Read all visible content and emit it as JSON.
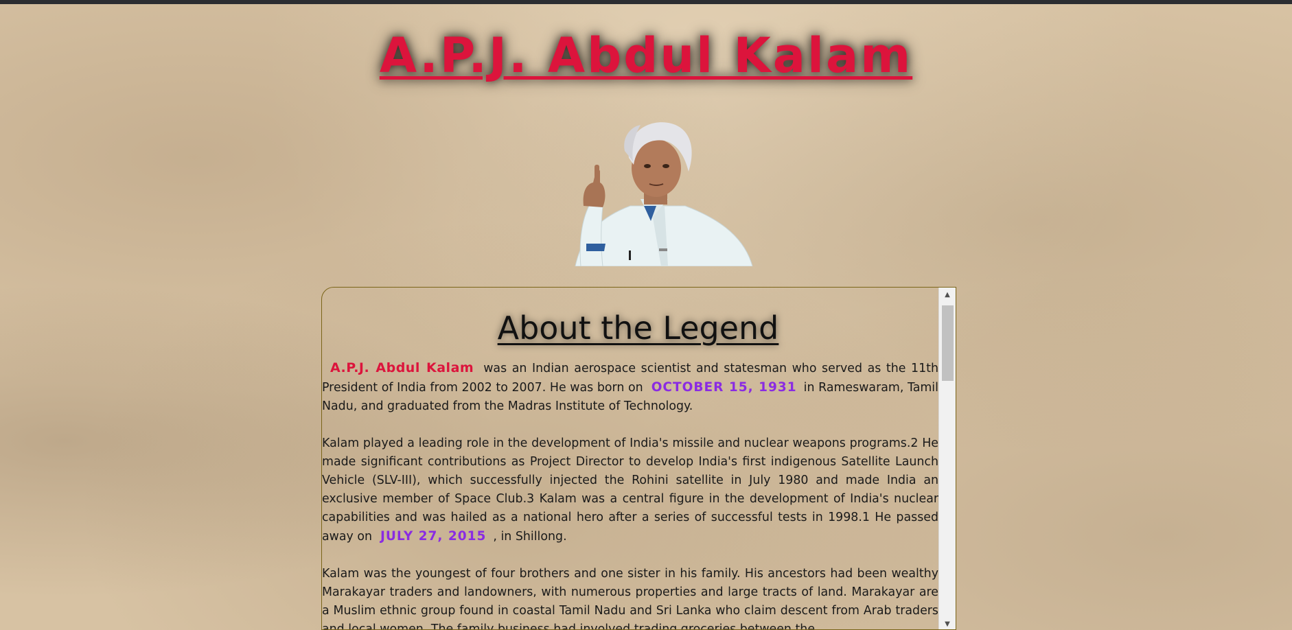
{
  "header": {
    "title": "A.P.J. Abdul Kalam"
  },
  "portrait": {
    "description_icon": "portrait-photo"
  },
  "about": {
    "heading": "About the Legend",
    "p1": {
      "name": "A.P.J. Abdul Kalam",
      "text1": "was an Indian aerospace scientist and statesman who served as the 11th President of India from 2002 to 2007. He was born on",
      "birth_date": "OCTOBER 15, 1931",
      "text2": "in Rameswaram, Tamil Nadu, and graduated from the Madras Institute of Technology."
    },
    "p2": {
      "text1": "Kalam played a leading role in the development of India's missile and nuclear weapons programs.2 He made significant contributions as Project Director to develop India's first indigenous Satellite Launch Vehicle (SLV-III), which successfully injected the Rohini satellite in July 1980 and made India an exclusive member of Space Club.3 Kalam was a central figure in the development of India's nuclear capabilities and was hailed as a national hero after a series of successful tests in 1998.1 He passed away on",
      "death_date": "JULY 27, 2015",
      "text2": ", in Shillong."
    },
    "p3": {
      "text": "Kalam was the youngest of four brothers and one sister in his family. His ancestors had been wealthy Marakayar traders and landowners, with numerous properties and large tracts of land. Marakayar are a Muslim ethnic group found in coastal Tamil Nadu and Sri Lanka who claim descent from Arab traders and local women. The family business had involved trading groceries between the"
    }
  },
  "colors": {
    "title": "#dc143c",
    "name_highlight": "#dc143c",
    "date_highlight": "#8a2be2",
    "box_border": "#7a6418"
  },
  "scrollbar": {
    "up_icon": "chevron-up-icon",
    "down_icon": "chevron-down-icon"
  }
}
